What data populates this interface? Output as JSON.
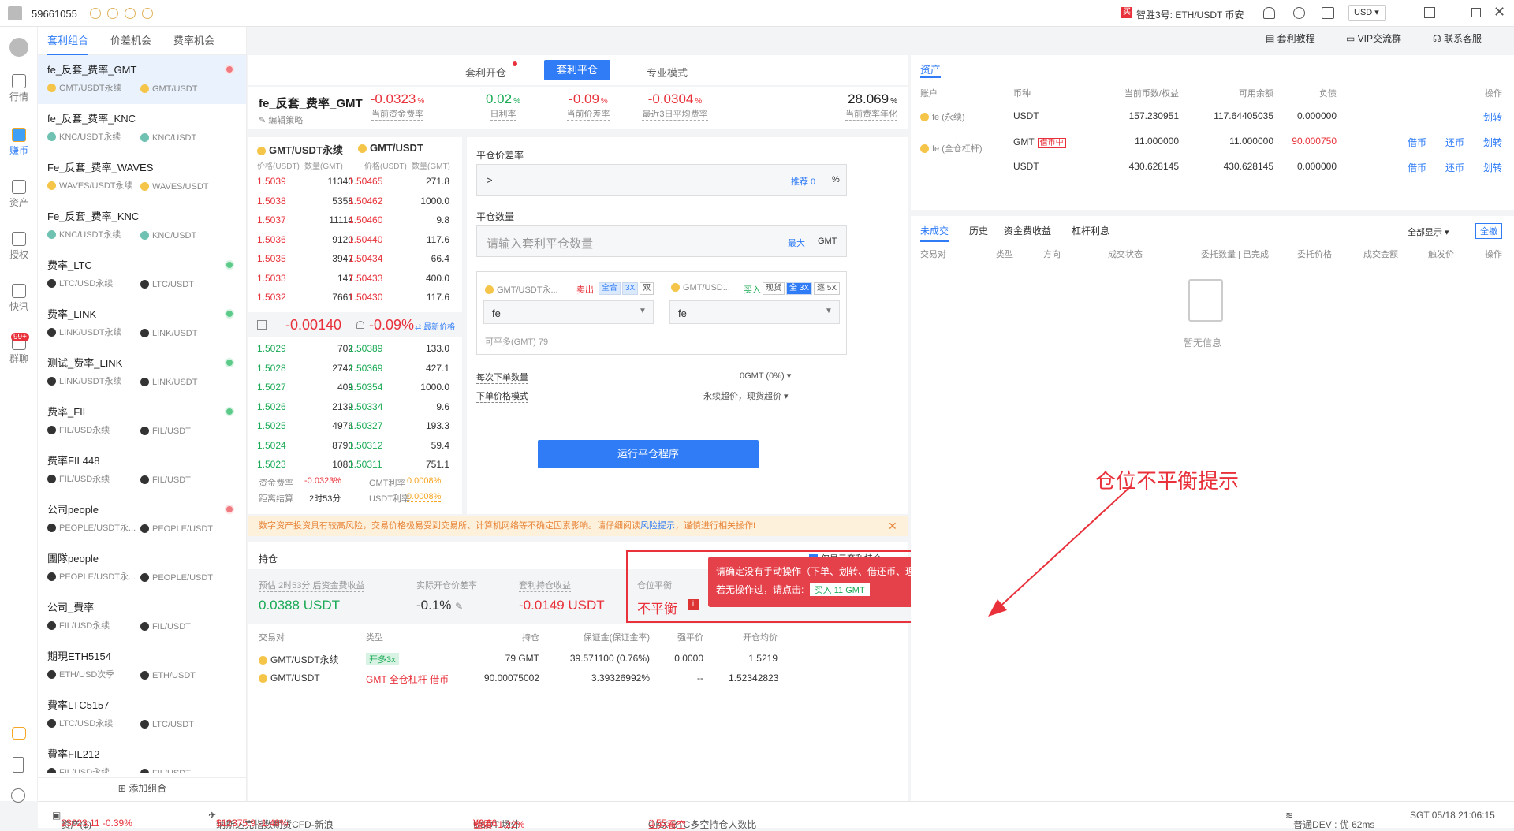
{
  "topbar": {
    "user_id": "59661055",
    "notice": "智胜3号: ETH/USDT 币安",
    "currency": "USD"
  },
  "leftnav": [
    "行情",
    "赚币",
    "资产",
    "授权",
    "快讯",
    "群聊"
  ],
  "leftnav_badge": "99+",
  "strategy_tabs": [
    "套利组合",
    "价差机会",
    "费率机会"
  ],
  "strategies": [
    {
      "name": "fe_反套_费率_GMT",
      "p1": "GMT/USDT永续",
      "p2": "GMT/USDT",
      "coin": "gmt",
      "dot": "red",
      "active": true
    },
    {
      "name": "fe_反套_费率_KNC",
      "p1": "KNC/USDT永续",
      "p2": "KNC/USDT",
      "coin": "knc",
      "dot": ""
    },
    {
      "name": "Fe_反套_费率_WAVES",
      "p1": "WAVES/USDT永续",
      "p2": "WAVES/USDT",
      "coin": "gmt",
      "dot": ""
    },
    {
      "name": "Fe_反套_费率_KNC",
      "p1": "KNC/USDT永续",
      "p2": "KNC/USDT",
      "coin": "knc",
      "dot": ""
    },
    {
      "name": "费率_LTC",
      "p1": "LTC/USD永续",
      "p2": "LTC/USDT",
      "coin": "blk",
      "dot": "green"
    },
    {
      "name": "费率_LINK",
      "p1": "LINK/USDT永续",
      "p2": "LINK/USDT",
      "coin": "blk",
      "dot": "green"
    },
    {
      "name": "测试_费率_LINK",
      "p1": "LINK/USDT永续",
      "p2": "LINK/USDT",
      "coin": "blk",
      "dot": "green"
    },
    {
      "name": "费率_FIL",
      "p1": "FIL/USD永续",
      "p2": "FIL/USDT",
      "coin": "fil",
      "dot": "green"
    },
    {
      "name": "费率FIL448",
      "p1": "FIL/USD永续",
      "p2": "FIL/USDT",
      "coin": "fil",
      "dot": ""
    },
    {
      "name": "公司people",
      "p1": "PEOPLE/USDT永...",
      "p2": "PEOPLE/USDT",
      "coin": "blk",
      "dot": "red"
    },
    {
      "name": "團隊people",
      "p1": "PEOPLE/USDT永...",
      "p2": "PEOPLE/USDT",
      "coin": "blk",
      "dot": ""
    },
    {
      "name": "公司_費率",
      "p1": "FIL/USD永续",
      "p2": "FIL/USDT",
      "coin": "fil",
      "dot": ""
    },
    {
      "name": "期現ETH5154",
      "p1": "ETH/USD次季",
      "p2": "ETH/USDT",
      "coin": "blk",
      "dot": ""
    },
    {
      "name": "費率LTC5157",
      "p1": "LTC/USD永续",
      "p2": "LTC/USDT",
      "coin": "blk",
      "dot": ""
    },
    {
      "name": "費率FIL212",
      "p1": "FIL/USD永续",
      "p2": "FIL/USDT",
      "coin": "fil",
      "dot": ""
    }
  ],
  "add_group": "添加组合",
  "mode_tabs": [
    "套利开仓",
    "套利平仓",
    "专业模式"
  ],
  "header": {
    "name": "fe_反套_费率_GMT",
    "edit": "编辑策略",
    "kpis": [
      {
        "v": "-0.0323",
        "u": "%",
        "l": "当前资金费率"
      },
      {
        "v": "0.02",
        "u": "%",
        "l": "日利率"
      },
      {
        "v": "-0.09",
        "u": "%",
        "l": "当前价差率"
      },
      {
        "v": "-0.0304",
        "u": "%",
        "l": "最近3日平均费率"
      },
      {
        "v": "28.069",
        "u": "%",
        "l": "当前费率年化"
      }
    ]
  },
  "orderbook": {
    "left_title": "GMT/USDT永续",
    "right_title": "GMT/USDT",
    "cols": [
      "价格(USDT)",
      "数量(GMT)",
      "价格(USDT)",
      "数量(GMT)"
    ],
    "asks": [
      [
        "1.5039",
        "11340",
        "1.50465",
        "271.8"
      ],
      [
        "1.5038",
        "5358",
        "1.50462",
        "1000.0"
      ],
      [
        "1.5037",
        "11114",
        "1.50460",
        "9.8"
      ],
      [
        "1.5036",
        "9120",
        "1.50440",
        "117.6"
      ],
      [
        "1.5035",
        "3947",
        "1.50434",
        "66.4"
      ],
      [
        "1.5033",
        "147",
        "1.50433",
        "400.0"
      ],
      [
        "1.5032",
        "7661",
        "1.50430",
        "117.6"
      ]
    ],
    "mid": {
      "spread": "-0.00140",
      "pct": "-0.09%",
      "latest": "最新价格"
    },
    "bids": [
      [
        "1.5029",
        "702",
        "1.50389",
        "133.0"
      ],
      [
        "1.5028",
        "2742",
        "1.50369",
        "427.1"
      ],
      [
        "1.5027",
        "409",
        "1.50354",
        "1000.0"
      ],
      [
        "1.5026",
        "2139",
        "1.50334",
        "9.6"
      ],
      [
        "1.5025",
        "4976",
        "1.50327",
        "193.3"
      ],
      [
        "1.5024",
        "8790",
        "1.50312",
        "59.4"
      ],
      [
        "1.5023",
        "1080",
        "1.50311",
        "751.1"
      ]
    ],
    "footer": {
      "fund_rate_l": "资金费率",
      "fund_rate_v": "-0.0323%",
      "gmt_rate_l": "GMT利率",
      "gmt_rate_v": "0.0008%",
      "settle_l": "距离结算",
      "settle_v": "2时53分",
      "usdt_rate_l": "USDT利率",
      "usdt_rate_v": "0.0008%"
    }
  },
  "form": {
    "spread_label": "平仓价差率",
    "spread_value": ">",
    "recommend": "推荐 0",
    "pct": "%",
    "qty_label": "平仓数量",
    "qty_placeholder": "请输入套利平仓数量",
    "max": "最大",
    "unit": "GMT",
    "leg1": {
      "pair": "GMT/USDT永...",
      "side": "卖出",
      "t1": "全合",
      "t2": "3X",
      "t3": "双",
      "acct": "fe"
    },
    "leg2": {
      "pair": "GMT/USD...",
      "side": "买入",
      "t1": "现货",
      "t2": "全 3X",
      "t3": "逐 5X",
      "acct": "fe"
    },
    "can_close": "可平多(GMT) 79",
    "per_order_l": "每次下单数量",
    "per_order_v": "0GMT (0%)",
    "price_mode_l": "下单价格模式",
    "price_mode_v": "永续超价，现货超价",
    "run": "运行平仓程序"
  },
  "risk": {
    "text": "数字资产投资具有较高风险，交易价格极易受到交易所、计算机网络等不确定因素影响。请仔细阅读",
    "link": "风险提示",
    "tail": "，谨慎进行相关操作!"
  },
  "positions": {
    "title": "持仓",
    "only": "仅显示套利持仓",
    "est_l": "预估 2时53分 后资金费收益",
    "est_v": "0.0388 USDT",
    "actual_l": "实际开仓价差率",
    "actual_v": "-0.1%",
    "hold_l": "套利持仓收益",
    "hold_v": "-0.0149 USDT",
    "bal_l": "仓位平衡",
    "bal_v": "不平衡",
    "tip1": "请确定没有手动操作（下单、划转、借还币、理财）",
    "tip2": "若无操作过，请点击:",
    "tip_btn": "买入 11 GMT",
    "cols": [
      "交易对",
      "类型",
      "持仓",
      "保证金(保证金率)",
      "强平价",
      "开仓均价"
    ],
    "rows": [
      [
        "GMT/USDT永续",
        "开多3x",
        "79 GMT",
        "39.571100 (0.76%)",
        "0.0000",
        "1.5219"
      ],
      [
        "GMT/USDT",
        "GMT 全仓杠杆 借币",
        "90.00075002",
        "3.39326992%",
        "--",
        "1.52342823"
      ]
    ]
  },
  "annotation": "仓位不平衡提示",
  "assets": {
    "title": "资产",
    "cols": [
      "账户",
      "币种",
      "当前币数/权益",
      "可用余额",
      "负债",
      "操作"
    ],
    "rows": [
      {
        "acct": "fe (永续)",
        "coin": "USDT",
        "tag": "",
        "a": "157.230951",
        "b": "117.64405035",
        "c": "0.000000",
        "ops": [
          "划转"
        ]
      },
      {
        "acct": "fe (全仓杠杆)",
        "coin": "GMT",
        "tag": "借币中",
        "a": "11.000000",
        "b": "11.000000",
        "c": "90.000750",
        "ops": [
          "借币",
          "还币",
          "划转"
        ]
      },
      {
        "acct": "",
        "coin": "USDT",
        "tag": "",
        "a": "430.628145",
        "b": "430.628145",
        "c": "0.000000",
        "ops": [
          "借币",
          "还币",
          "划转"
        ]
      }
    ]
  },
  "orders": {
    "tabs": [
      "未成交",
      "历史",
      "资金费收益",
      "杠杆利息"
    ],
    "filter": "全部显示",
    "cancel_all": "全撤",
    "cols": [
      "交易对",
      "类型",
      "方向",
      "成交状态",
      "委托数量 | 已完成",
      "委托价格",
      "成交金额",
      "触发价",
      "操作"
    ],
    "empty": "暂无信息"
  },
  "top_right": [
    "套利教程",
    "VIP交流群",
    "联系客服"
  ],
  "bottom": {
    "asset_l": "资产($)",
    "asset_v": "23023.11 -0.39%",
    "nas_l": "纳斯达克指数期货CFD-新浪",
    "nas_v": "$12375.9 -1.48%",
    "usdt_l": "USDT 场外",
    "usdt_v": "¥6.66",
    "usdt_p": "溢價 -1.22%",
    "okx_l": "OKX-BTC多空持仓人数比",
    "okx_v": "1.55",
    "okx_s": "主力看空",
    "net": "普通DEV : 优 62ms",
    "time": "SGT 05/18 21:06:15"
  }
}
